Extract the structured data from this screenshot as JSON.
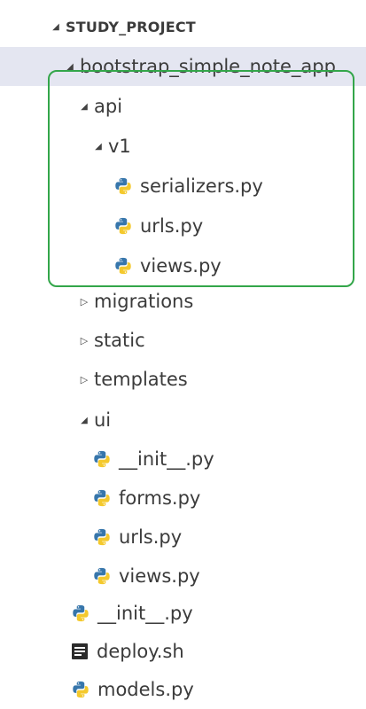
{
  "explorer": {
    "root": "STUDY_PROJECT",
    "items": [
      {
        "label": "bootstrap_simple_note_app",
        "kind": "folder",
        "expanded": true
      },
      {
        "label": "api",
        "kind": "folder",
        "expanded": true
      },
      {
        "label": "v1",
        "kind": "folder",
        "expanded": true
      },
      {
        "label": "serializers.py",
        "kind": "python-file",
        "icon": "python-icon"
      },
      {
        "label": "urls.py",
        "kind": "python-file",
        "icon": "python-icon"
      },
      {
        "label": "views.py",
        "kind": "python-file",
        "icon": "python-icon"
      },
      {
        "label": "migrations",
        "kind": "folder",
        "expanded": false
      },
      {
        "label": "static",
        "kind": "folder",
        "expanded": false
      },
      {
        "label": "templates",
        "kind": "folder",
        "expanded": false
      },
      {
        "label": "ui",
        "kind": "folder",
        "expanded": true
      },
      {
        "label": "__init__.py",
        "kind": "python-file",
        "icon": "python-icon"
      },
      {
        "label": "forms.py",
        "kind": "python-file",
        "icon": "python-icon"
      },
      {
        "label": "urls.py",
        "kind": "python-file",
        "icon": "python-icon"
      },
      {
        "label": "views.py",
        "kind": "python-file",
        "icon": "python-icon"
      },
      {
        "label": "__init__.py",
        "kind": "python-file",
        "icon": "python-icon"
      },
      {
        "label": "deploy.sh",
        "kind": "shell-file",
        "icon": "shell-script-icon"
      },
      {
        "label": "models.py",
        "kind": "python-file",
        "icon": "python-icon"
      }
    ]
  },
  "colors": {
    "selected_row": "#e4e6f1",
    "highlight_border": "#33a64a",
    "python_blue": "#3776ab",
    "python_yellow": "#f4c92d"
  }
}
